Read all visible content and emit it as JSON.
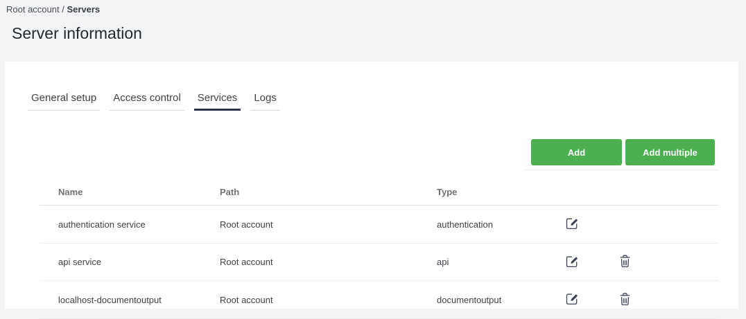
{
  "breadcrumb": {
    "root": "Root account",
    "separator": " / ",
    "current": "Servers"
  },
  "page_title": "Server information",
  "tabs": [
    {
      "label": "General setup",
      "active": false
    },
    {
      "label": "Access control",
      "active": false
    },
    {
      "label": "Services",
      "active": true
    },
    {
      "label": "Logs",
      "active": false
    }
  ],
  "toolbar": {
    "add_label": "Add",
    "add_multiple_label": "Add multiple"
  },
  "table": {
    "columns": {
      "name": "Name",
      "path": "Path",
      "type": "Type"
    },
    "rows": [
      {
        "name": "authentication service",
        "path": "Root account",
        "type": "authentication",
        "can_edit": true,
        "can_delete": false
      },
      {
        "name": "api service",
        "path": "Root account",
        "type": "api",
        "can_edit": true,
        "can_delete": true
      },
      {
        "name": "localhost-documentoutput",
        "path": "Root account",
        "type": "documentoutput",
        "can_edit": true,
        "can_delete": true
      }
    ]
  },
  "icons": {
    "edit": "edit-icon",
    "delete": "trash-icon"
  },
  "colors": {
    "accent_green": "#4caf50",
    "active_tab_underline": "#2b3245",
    "icon": "#3c4454",
    "page_background": "#f3f4f6"
  }
}
